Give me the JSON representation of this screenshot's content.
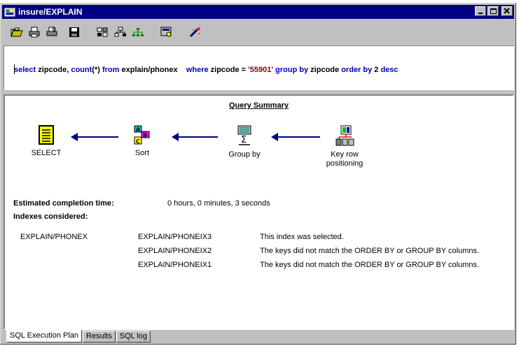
{
  "window": {
    "title": "insure/EXPLAIN",
    "buttons": [
      "minimize",
      "maximize",
      "close"
    ]
  },
  "toolbar": {
    "icons": [
      "open-folder-icon",
      "print-icon",
      "print-preview-icon",
      "save-icon",
      "index-icon",
      "hierarchy-icon",
      "tree-icon",
      "settings-icon",
      "run-icon"
    ]
  },
  "sql": {
    "select_kw": "select",
    "col1": "zipcode,",
    "count_kw": "count",
    "count_arg": "(*)",
    "from_kw": "from",
    "table": "explain/phonex",
    "where_kw": "where",
    "where_col": "zipcode =",
    "where_val": "'55901'",
    "group_kw": "group by",
    "group_col": "zipcode",
    "order_kw": "order by",
    "order_num": "2",
    "desc_kw": "desc"
  },
  "summary": {
    "title": "Query Summary",
    "nodes": [
      {
        "label": "SELECT"
      },
      {
        "label": "Sort"
      },
      {
        "label": "Group by"
      },
      {
        "label_line1": "Key row",
        "label_line2": "positioning"
      }
    ],
    "completion_label": "Estimated completion time:",
    "completion_value": "0 hours, 0 minutes, 3 seconds",
    "indexes_label": "Indexes considered:",
    "table_name": "EXPLAIN/PHONEX",
    "indexes": [
      {
        "name": "EXPLAIN/PHONEIX3",
        "note": "This index was selected."
      },
      {
        "name": "EXPLAIN/PHONEIX2",
        "note": "The keys did not match the ORDER BY or GROUP BY columns."
      },
      {
        "name": "EXPLAIN/PHONEIX1",
        "note": "The keys did not match the ORDER BY or GROUP BY columns."
      }
    ]
  },
  "tabs": [
    {
      "label": "SQL Execution Plan",
      "active": true
    },
    {
      "label": "Results",
      "active": false
    },
    {
      "label": "SQL log",
      "active": false
    }
  ],
  "colors": {
    "titlebar": "#000080",
    "keyword": "#0000c0",
    "string": "#800000",
    "arrow": "#000080"
  }
}
